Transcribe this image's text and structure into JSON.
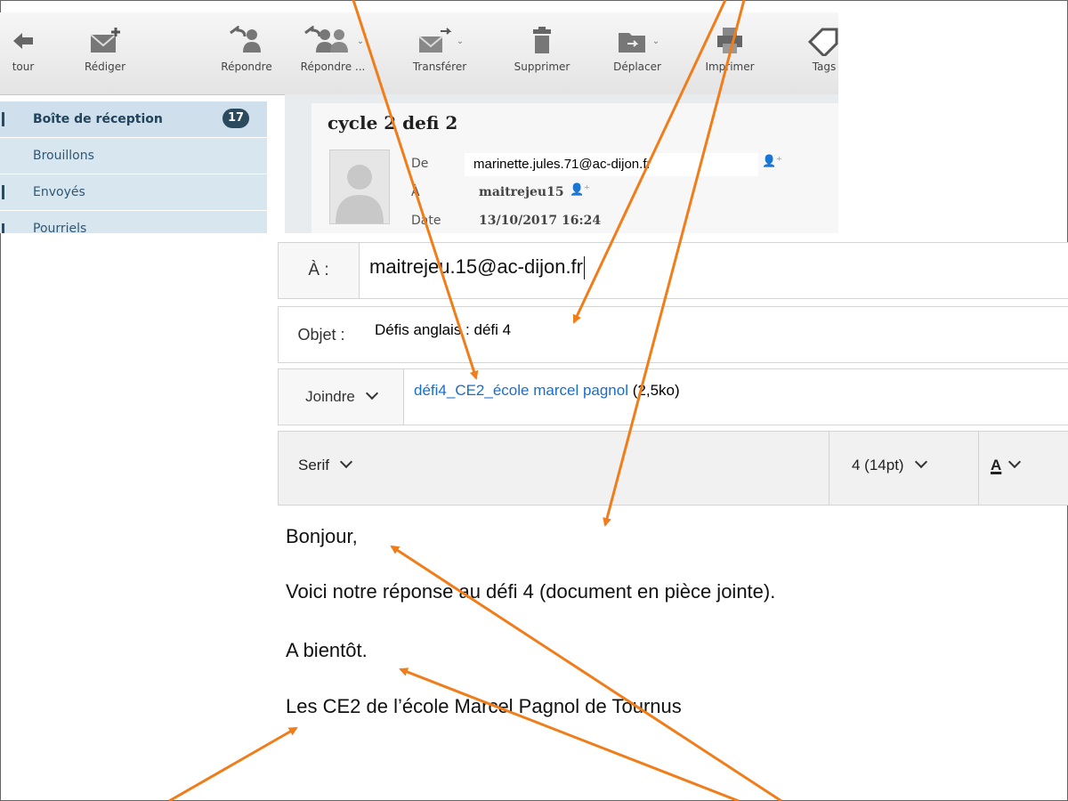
{
  "toolbar": {
    "buttons": [
      {
        "name": "back",
        "label": "tour",
        "icon": "back-arrow-icon"
      },
      {
        "name": "compose",
        "label": "Rédiger",
        "icon": "compose-envelope-icon"
      },
      {
        "name": "reply",
        "label": "Répondre",
        "icon": "reply-icon"
      },
      {
        "name": "reply-all",
        "label": "Répondre ...",
        "icon": "reply-all-icon"
      },
      {
        "name": "forward",
        "label": "Transférer",
        "icon": "forward-envelope-icon"
      },
      {
        "name": "delete",
        "label": "Supprimer",
        "icon": "trash-icon"
      },
      {
        "name": "move",
        "label": "Déplacer",
        "icon": "folder-move-icon"
      },
      {
        "name": "print",
        "label": "Imprimer",
        "icon": "printer-icon"
      },
      {
        "name": "tags",
        "label": "Tags",
        "icon": "tag-icon"
      }
    ]
  },
  "folders": [
    {
      "label": "Boîte de réception",
      "count": "17",
      "active": true
    },
    {
      "label": "Brouillons"
    },
    {
      "label": "Envoyés"
    },
    {
      "label": "Pourriels"
    }
  ],
  "message": {
    "subject": "cycle 2 defi 2",
    "from_label": "De",
    "from_value": "marinette.jules.71@ac-dijon.fr",
    "to_label": "À",
    "to_value": "maitrejeu15",
    "date_label": "Date",
    "date_value": "13/10/2017 16:24"
  },
  "compose": {
    "to_label": "À :",
    "to_value": "maitrejeu.15@ac-dijon.fr",
    "subject_label": "Objet :",
    "subject_value": "Défis anglais : défi 4",
    "attach_label": "Joindre",
    "attachment_name": "défi4_CE2_école marcel pagnol",
    "attachment_size": "(2,5ko)",
    "font_family": "Serif",
    "font_size": "4 (14pt)",
    "text_color_button": "A"
  },
  "body": {
    "greeting": "Bonjour,",
    "line1": "Voici notre réponse au défi 4 (document en pièce jointe).",
    "closing": "A bientôt.",
    "signature": "Les CE2 de l’école Marcel Pagnol de Tournus"
  },
  "colors": {
    "arrow": "#f07d1a",
    "link": "#1a6ec8",
    "badge": "#2b4a5e",
    "sidebar": "#d8e6ef"
  }
}
